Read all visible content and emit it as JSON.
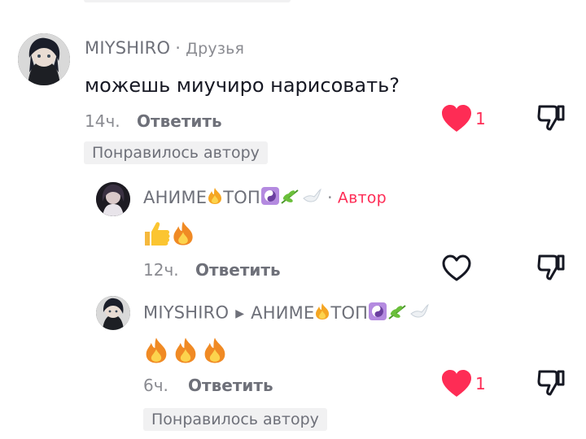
{
  "comments": [
    {
      "user": "MIYSHIRO",
      "tag": "Друзья",
      "text": "можешь миучиро нарисовать?",
      "time": "14ч.",
      "reply_label": "Ответить",
      "like_count": "1",
      "liked": true,
      "author_liked_label": "Понравилось автору"
    },
    {
      "user": "АНИМЕ",
      "user_suffix": "ТОП",
      "tag": "Автор",
      "time": "12ч.",
      "reply_label": "Ответить",
      "liked": false
    },
    {
      "user": "MIYSHIRO",
      "reply_to": "АНИМЕ",
      "reply_to_suffix": "ТОП",
      "time": "6ч.",
      "reply_label": "Ответить",
      "like_count": "1",
      "liked": true,
      "author_liked_label": "Понравилось автору"
    }
  ],
  "icons": {
    "like": "heart-icon",
    "dislike": "thumbs-down-icon",
    "fire": "fire-emoji-icon",
    "thumbs_up": "thumbs-up-emoji-icon"
  },
  "colors": {
    "accent": "#fe2c55",
    "text": "#161823",
    "muted": "#8a8b91",
    "chip_bg": "#f1f1f2"
  }
}
